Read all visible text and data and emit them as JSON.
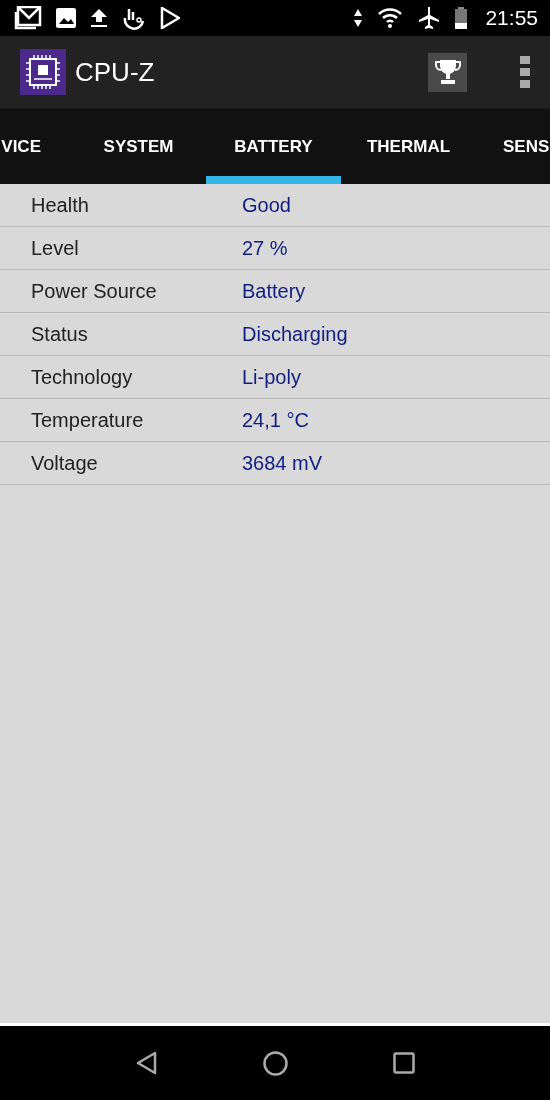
{
  "status_bar": {
    "time": "21:55"
  },
  "app_bar": {
    "title": "CPU-Z"
  },
  "tabs": [
    {
      "label": "VICE",
      "selected": false
    },
    {
      "label": "SYSTEM",
      "selected": false
    },
    {
      "label": "BATTERY",
      "selected": true
    },
    {
      "label": "THERMAL",
      "selected": false
    },
    {
      "label": "SENS",
      "selected": false
    }
  ],
  "rows": [
    {
      "label": "Health",
      "value": "Good"
    },
    {
      "label": "Level",
      "value": "27 %"
    },
    {
      "label": "Power Source",
      "value": "Battery"
    },
    {
      "label": "Status",
      "value": "Discharging"
    },
    {
      "label": "Technology",
      "value": "Li-poly"
    },
    {
      "label": "Temperature",
      "value": "24,1 °C"
    },
    {
      "label": "Voltage",
      "value": "3684 mV"
    }
  ]
}
